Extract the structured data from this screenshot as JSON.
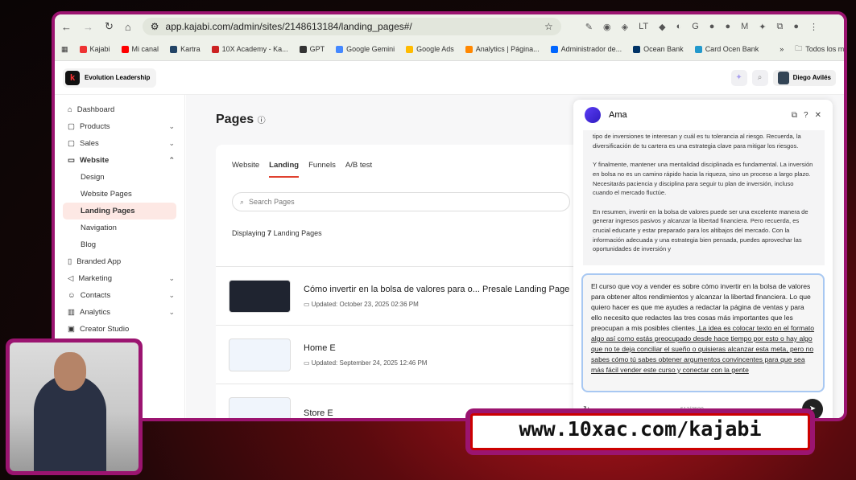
{
  "browser": {
    "url": "app.kajabi.com/admin/sites/2148613184/landing_pages#/",
    "bookmarks": [
      "Kajabi",
      "Mi canal",
      "Kartra",
      "10X Academy - Ka...",
      "GPT",
      "Google Gemini",
      "Google Ads",
      "Analytics | Página...",
      "Administrador de...",
      "Ocean Bank",
      "Card Ocen Bank"
    ],
    "more": "»",
    "all_bookmarks": "Todos los marcadores"
  },
  "header": {
    "brand": "Evolution Leadership",
    "user": "Diego Avilés"
  },
  "sidebar": {
    "items": [
      {
        "label": "Dashboard",
        "icon": "⌂"
      },
      {
        "label": "Products",
        "icon": "▢",
        "chev": "⌄"
      },
      {
        "label": "Sales",
        "icon": "▢",
        "chev": "⌄"
      },
      {
        "label": "Website",
        "icon": "▭",
        "chev": "⌃",
        "bold": true
      },
      {
        "label": "Design",
        "sub": true
      },
      {
        "label": "Website Pages",
        "sub": true
      },
      {
        "label": "Landing Pages",
        "sub": true,
        "active": true
      },
      {
        "label": "Navigation",
        "sub": true
      },
      {
        "label": "Blog",
        "sub": true
      },
      {
        "label": "Branded App",
        "icon": "▯"
      },
      {
        "label": "Marketing",
        "icon": "◁",
        "chev": "⌄"
      },
      {
        "label": "Contacts",
        "icon": "☺",
        "chev": "⌄"
      },
      {
        "label": "Analytics",
        "icon": "▥",
        "chev": "⌄"
      },
      {
        "label": "Creator Studio",
        "icon": "▣"
      }
    ]
  },
  "main": {
    "title": "Pages",
    "tabs": [
      "Website",
      "Landing",
      "Funnels",
      "A/B test"
    ],
    "active_tab": 1,
    "search_placeholder": "Search Pages",
    "displaying_prefix": "Displaying",
    "count": "7",
    "displaying_suffix": "Landing Pages",
    "pages": [
      {
        "title": "Cómo invertir en la bolsa de valores para o... Presale Landing Page",
        "updated": "Updated: October 23, 2025 02:36 PM"
      },
      {
        "title": "Home E",
        "updated": "Updated: September 24, 2025 12:46 PM"
      },
      {
        "title": "Store E",
        "updated": ""
      }
    ]
  },
  "chat": {
    "title": "Ama",
    "messages": [
      "tipo de inversiones te interesan y cuál es tu tolerancia al riesgo. Recuerda, la diversificación de tu cartera es una estrategia clave para mitigar los riesgos.",
      "Y finalmente, mantener una mentalidad disciplinada es fundamental. La inversión en bolsa no es un camino rápido hacia la riqueza, sino un proceso a largo plazo. Necesitarás paciencia y disciplina para seguir tu plan de inversión, incluso cuando el mercado fluctúe.",
      "En resumen, invertir en la bolsa de valores puede ser una excelente manera de generar ingresos pasivos y alcanzar la libertad financiera. Pero recuerda, es crucial educarte y estar preparado para los altibajos del mercado. Con la información adecuada y una estrategia bien pensada, puedes aprovechar las oportunidades de inversión y"
    ],
    "input_plain": "El curso que voy a vender es sobre cómo invertir en la bolsa de valores para obtener altos rendimientos y alcanzar la libertad financiera. Lo que quiero hacer es que me ayudes a redactar la página de ventas y para ello necesito que redactes las tres cosas más importantes que les preocupan a mis posibles clientes.",
    "input_underlined": " La idea es colocar texto en el formato algo así como estás preocupado desde hace tiempo por esto o hay algo que no te deja conciliar el sueño o quisieras alcanzar esta meta, pero no sabes cómo tú sabes obtener argumentos convincentes para que sea más fácil vender este curso y conectar con la gente",
    "char_count": "613/2500"
  },
  "overlay": {
    "url_banner": "www.10xac.com/kajabi"
  }
}
